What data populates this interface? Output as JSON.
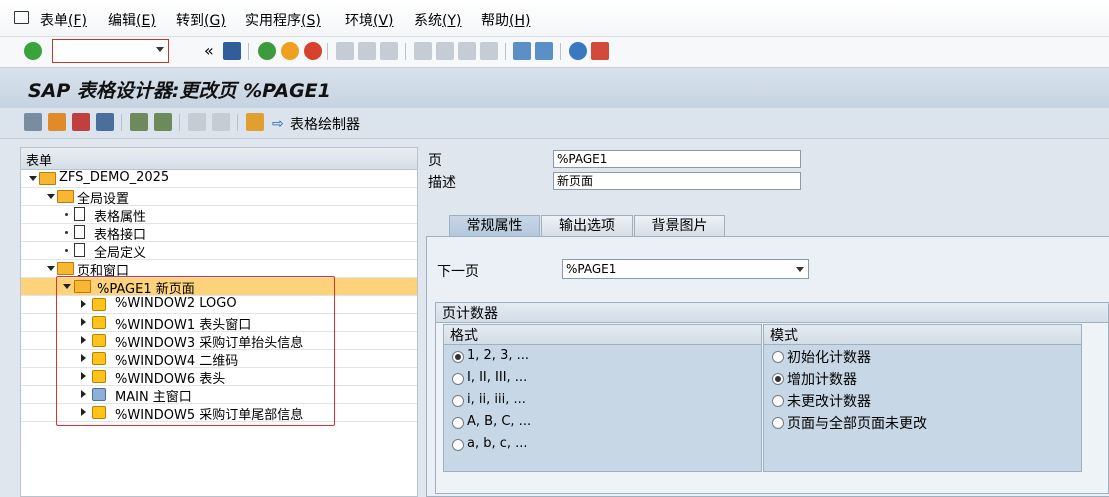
{
  "menu": {
    "items": [
      {
        "label": "表单",
        "key": "(F)"
      },
      {
        "label": "编辑",
        "key": "(E)"
      },
      {
        "label": "转到",
        "key": "(G)"
      },
      {
        "label": "实用程序",
        "key": "(S)"
      },
      {
        "label": "环境",
        "key": "(V)"
      },
      {
        "label": "系统",
        "key": "(Y)"
      },
      {
        "label": "帮助",
        "key": "(H)"
      }
    ]
  },
  "toolbar": {
    "command_value": "",
    "back_chevron": "«"
  },
  "title": "SAP 表格设计器:更改页 %PAGE1",
  "app_toolbar": {
    "form_painter_label": "表格绘制器"
  },
  "tree": {
    "header": "表单",
    "root": "ZFS_DEMO_2025",
    "global_settings": "全局设置",
    "form_attributes": "表格属性",
    "form_interface": "表格接口",
    "global_definitions": "全局定义",
    "pages_windows": "页和窗口",
    "page1": "%PAGE1 新页面",
    "windows": [
      {
        "label": "%WINDOW2 LOGO",
        "main": false
      },
      {
        "label": "%WINDOW1 表头窗口",
        "main": false
      },
      {
        "label": "%WINDOW3 采购订单抬头信息",
        "main": false
      },
      {
        "label": "%WINDOW4 二维码",
        "main": false
      },
      {
        "label": "%WINDOW6 表头",
        "main": false
      },
      {
        "label": "MAIN 主窗口",
        "main": true
      },
      {
        "label": "%WINDOW5 采购订单尾部信息",
        "main": false
      }
    ]
  },
  "detail": {
    "page_label": "页",
    "page_value": "%PAGE1",
    "desc_label": "描述",
    "desc_value": "新页面",
    "tabs": [
      "常规属性",
      "输出选项",
      "背景图片"
    ],
    "next_page_label": "下一页",
    "next_page_value": "%PAGE1",
    "counter_group": "页计数器",
    "format_header": "格式",
    "mode_header": "模式",
    "formats": [
      "1, 2, 3, ...",
      "I, II, III, ...",
      "i, ii, iii, ...",
      "A, B, C, ...",
      "a, b, c, ..."
    ],
    "format_selected": 0,
    "modes": [
      "初始化计数器",
      "增加计数器",
      "未更改计数器",
      "页面与全部页面未更改"
    ],
    "mode_selected": 1
  },
  "colors": {
    "selection": "#fcd27a",
    "highlight_box": "#e0302a",
    "folder": "#f7b733"
  }
}
